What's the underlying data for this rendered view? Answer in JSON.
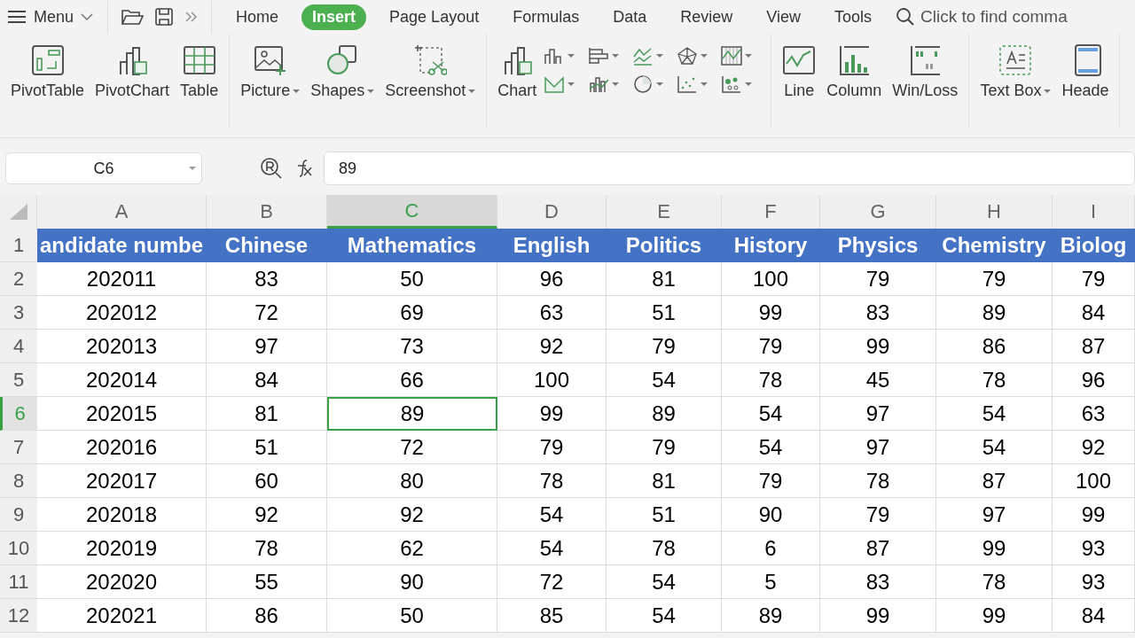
{
  "menu_bar": {
    "menu": "Menu",
    "tabs": [
      {
        "label": "Home",
        "selected": false
      },
      {
        "label": "Insert",
        "selected": true
      },
      {
        "label": "Page Layout",
        "selected": false
      },
      {
        "label": "Formulas",
        "selected": false
      },
      {
        "label": "Data",
        "selected": false
      },
      {
        "label": "Review",
        "selected": false
      },
      {
        "label": "View",
        "selected": false
      },
      {
        "label": "Tools",
        "selected": false
      }
    ],
    "search": {
      "placeholder": "Click to find comma"
    }
  },
  "ribbon": {
    "groups": [
      {
        "kind": "large",
        "items": [
          {
            "label": "PivotTable",
            "dropdown": false
          },
          {
            "label": "PivotChart",
            "dropdown": false
          },
          {
            "label": "Table",
            "dropdown": false
          }
        ]
      },
      {
        "kind": "large",
        "items": [
          {
            "label": "Picture",
            "dropdown": true
          },
          {
            "label": "Shapes",
            "dropdown": true
          },
          {
            "label": "Screenshot",
            "dropdown": true
          }
        ]
      },
      {
        "kind": "charts",
        "items": [
          {
            "label": "Chart",
            "dropdown": false
          }
        ],
        "small": [
          {
            "dropdown": true
          },
          {
            "dropdown": true
          },
          {
            "dropdown": true
          },
          {
            "dropdown": true
          },
          {
            "dropdown": true
          },
          {
            "dropdown": true
          },
          {
            "dropdown": true
          },
          {
            "dropdown": true
          },
          {
            "dropdown": true
          },
          {
            "dropdown": true
          }
        ]
      },
      {
        "kind": "large",
        "items": [
          {
            "label": "Line",
            "dropdown": false
          },
          {
            "label": "Column",
            "dropdown": false
          },
          {
            "label": "Win/Loss",
            "dropdown": false
          }
        ]
      },
      {
        "kind": "large",
        "items": [
          {
            "label": "Text Box",
            "dropdown": true
          },
          {
            "label": "Heade",
            "dropdown": false
          }
        ]
      }
    ]
  },
  "formula_bar": {
    "name_box": "C6",
    "formula": "89"
  },
  "sheet": {
    "columns": [
      {
        "label": "A",
        "selected": false
      },
      {
        "label": "B",
        "selected": false
      },
      {
        "label": "C",
        "selected": true
      },
      {
        "label": "D",
        "selected": false
      },
      {
        "label": "E",
        "selected": false
      },
      {
        "label": "F",
        "selected": false
      },
      {
        "label": "G",
        "selected": false
      },
      {
        "label": "H",
        "selected": false
      },
      {
        "label": "I",
        "selected": false
      }
    ],
    "rows": [
      {
        "number": "1",
        "selected": false,
        "header": true,
        "cells": [
          "andidate numbe",
          "Chinese",
          "Mathematics",
          "English",
          "Politics",
          "History",
          "Physics",
          "Chemistry",
          "Biolog"
        ]
      },
      {
        "number": "2",
        "selected": false,
        "header": false,
        "cells": [
          "202011",
          "83",
          "50",
          "96",
          "81",
          "100",
          "79",
          "79",
          "79"
        ]
      },
      {
        "number": "3",
        "selected": false,
        "header": false,
        "cells": [
          "202012",
          "72",
          "69",
          "63",
          "51",
          "99",
          "83",
          "89",
          "84"
        ]
      },
      {
        "number": "4",
        "selected": false,
        "header": false,
        "cells": [
          "202013",
          "97",
          "73",
          "92",
          "79",
          "79",
          "99",
          "86",
          "87"
        ]
      },
      {
        "number": "5",
        "selected": false,
        "header": false,
        "cells": [
          "202014",
          "84",
          "66",
          "100",
          "54",
          "78",
          "45",
          "78",
          "96"
        ]
      },
      {
        "number": "6",
        "selected": true,
        "header": false,
        "cells": [
          "202015",
          "81",
          "89",
          "99",
          "89",
          "54",
          "97",
          "54",
          "63"
        ]
      },
      {
        "number": "7",
        "selected": false,
        "header": false,
        "cells": [
          "202016",
          "51",
          "72",
          "79",
          "79",
          "54",
          "97",
          "54",
          "92"
        ]
      },
      {
        "number": "8",
        "selected": false,
        "header": false,
        "cells": [
          "202017",
          "60",
          "80",
          "78",
          "81",
          "79",
          "78",
          "87",
          "100"
        ]
      },
      {
        "number": "9",
        "selected": false,
        "header": false,
        "cells": [
          "202018",
          "92",
          "92",
          "54",
          "51",
          "90",
          "79",
          "97",
          "99"
        ]
      },
      {
        "number": "10",
        "selected": false,
        "header": false,
        "cells": [
          "202019",
          "78",
          "62",
          "54",
          "78",
          "6",
          "87",
          "99",
          "93"
        ]
      },
      {
        "number": "11",
        "selected": false,
        "header": false,
        "cells": [
          "202020",
          "55",
          "90",
          "72",
          "54",
          "5",
          "83",
          "78",
          "93"
        ]
      },
      {
        "number": "12",
        "selected": false,
        "header": false,
        "cells": [
          "202021",
          "86",
          "50",
          "85",
          "54",
          "89",
          "99",
          "99",
          "84"
        ]
      }
    ]
  }
}
